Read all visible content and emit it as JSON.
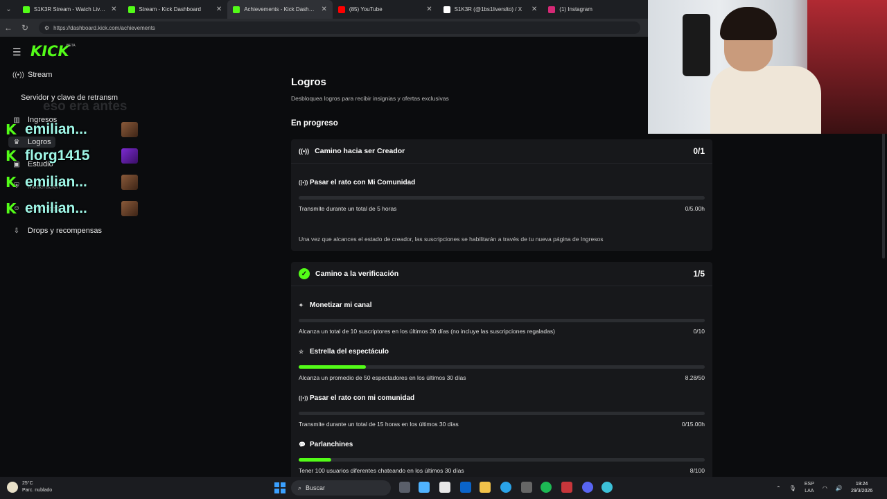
{
  "browser": {
    "tabs": [
      {
        "title": "S1K3R Stream - Watch Live on Kick",
        "color": "#53fc18",
        "active": false
      },
      {
        "title": "Stream - Kick Dashboard",
        "color": "#53fc18",
        "active": false
      },
      {
        "title": "Achievements - Kick Dashboard",
        "color": "#53fc18",
        "active": true
      },
      {
        "title": "(85) YouTube",
        "color": "#ff0000",
        "active": false
      },
      {
        "title": "S1K3R (@1bs1liverslto) / X",
        "color": "#ffffff",
        "active": false
      },
      {
        "title": "(1) Instagram",
        "color": "#d62976",
        "active": false
      }
    ],
    "url": "https://dashboard.kick.com/achievements"
  },
  "sidebar": {
    "logo": "KICK",
    "beta": "BETA",
    "items": [
      {
        "label": "Stream",
        "icon": "broadcast-icon"
      },
      {
        "label": "Servidor y clave de retransm"
      },
      {
        "label": "Ingresos",
        "icon": "chart-icon"
      },
      {
        "label": "Logros",
        "icon": "trophy-icon"
      },
      {
        "label": "Estudio",
        "icon": "studio-icon"
      },
      {
        "label": "Moderación",
        "icon": "shield-icon"
      },
      {
        "label": "Comunidad",
        "icon": "community-icon"
      },
      {
        "label": "Drops y recompensas",
        "icon": "gift-icon"
      }
    ],
    "ghost_text": "eso era antes"
  },
  "chat_overlay": [
    {
      "name": "emilian..."
    },
    {
      "name": "florg1415"
    },
    {
      "name": "emilian..."
    },
    {
      "name": "emilian..."
    }
  ],
  "main": {
    "title": "Logros",
    "description": "Desbloquea logros para recibir insignias y ofertas exclusivas",
    "section": "En progreso",
    "cards": [
      {
        "title": "Camino hacia ser Creador",
        "count": "0/1",
        "achievements": [
          {
            "name": "Pasar el rato con Mi Comunidad",
            "desc": "Transmite durante un total de 5 horas",
            "value": "0/5.00h",
            "progress": 0.0
          }
        ],
        "note": "Una vez que alcances el estado de creador, las suscripciones se habilitarán a través de tu nueva página de Ingresos"
      },
      {
        "title": "Camino a la verificación",
        "count": "1/5",
        "achievements": [
          {
            "name": "Monetizar mi canal",
            "desc": "Alcanza un total de 10 suscriptores en los últimos 30 días (no incluye las suscripciones regaladas)",
            "value": "0/10",
            "progress": 0.0
          },
          {
            "name": "Estrella del espectáculo",
            "desc": "Alcanza un promedio de 50 espectadores en los últimos 30 días",
            "value": "8.28/50",
            "progress": 0.1656
          },
          {
            "name": "Pasar el rato con mi comunidad",
            "desc": "Transmite durante un total de 15 horas en los últimos 30 días",
            "value": "0/15.00h",
            "progress": 0.0
          },
          {
            "name": "Parlanchines",
            "desc": "Tener 100 usuarios diferentes chateando en los últimos 30 días",
            "value": "8/100",
            "progress": 0.08
          }
        ]
      }
    ]
  },
  "taskbar": {
    "temp": "25°C",
    "weather": "Parc. nublado",
    "search": "Buscar",
    "lang1": "ESP",
    "lang2": "LAA",
    "time": "19:24",
    "date": "29/3/2026"
  }
}
